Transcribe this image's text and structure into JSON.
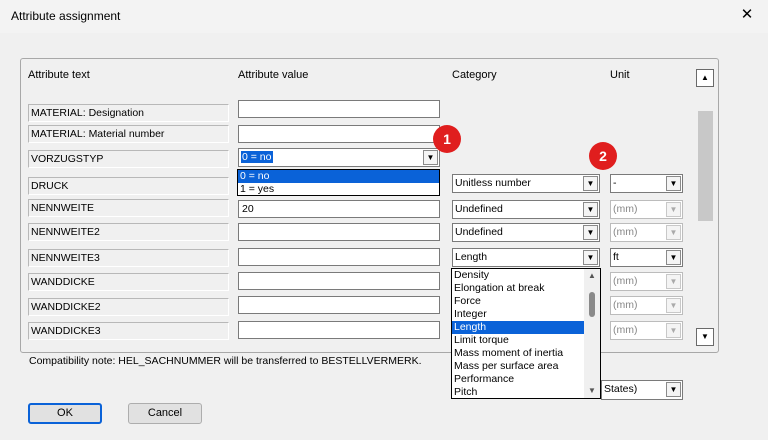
{
  "window": {
    "title": "Attribute assignment"
  },
  "headers": {
    "attribute_text": "Attribute text",
    "attribute_value": "Attribute value",
    "category": "Category",
    "unit": "Unit"
  },
  "rows": [
    {
      "label": "MATERIAL: Designation",
      "value": ""
    },
    {
      "label": "MATERIAL: Material number",
      "value": ""
    },
    {
      "label": "VORZUGSTYP",
      "value": "0 = no"
    },
    {
      "label": "DRUCK",
      "category": "Unitless number",
      "unit": "-"
    },
    {
      "label": "NENNWEITE",
      "value": "20",
      "category": "Undefined",
      "unit": "(mm)"
    },
    {
      "label": "NENNWEITE2",
      "value": "",
      "category": "Undefined",
      "unit": "(mm)"
    },
    {
      "label": "NENNWEITE3",
      "value": "",
      "category": "Length",
      "unit": "ft"
    },
    {
      "label": "WANDDICKE",
      "value": "",
      "unit": "(mm)"
    },
    {
      "label": "WANDDICKE2",
      "value": "",
      "unit": "(mm)"
    },
    {
      "label": "WANDDICKE3",
      "value": "",
      "unit": "(mm)"
    }
  ],
  "vorzugstyp_dropdown": {
    "options": [
      "0 = no",
      "1 = yes"
    ],
    "selected_index": 0
  },
  "category_dropdown": {
    "options": [
      "Density",
      "Elongation at break",
      "Force",
      "Integer",
      "Length",
      "Limit torque",
      "Mass moment of inertia",
      "Mass per surface area",
      "Performance",
      "Pitch"
    ],
    "selected_index": 4
  },
  "badges": {
    "one": "1",
    "two": "2"
  },
  "note": "Compatibility note: HEL_SACHNUMMER will be transferred to BESTELLVERMERK.",
  "units_system": {
    "value": "States)"
  },
  "buttons": {
    "ok": "OK",
    "cancel": "Cancel"
  },
  "colors": {
    "selection": "#0a62d8",
    "badge": "#e01e1e"
  }
}
